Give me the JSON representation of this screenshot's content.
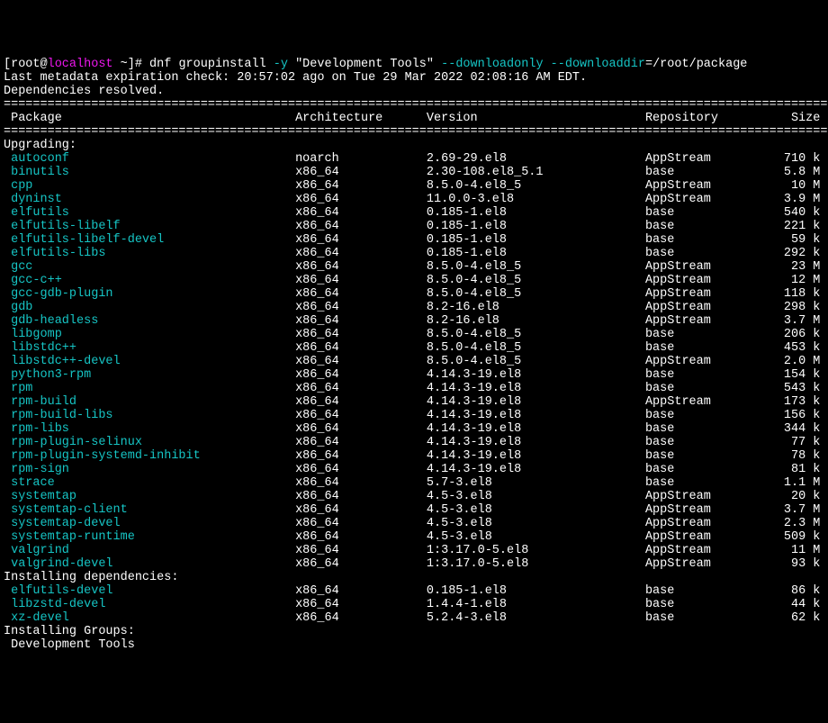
{
  "prompt": {
    "open": "[root@",
    "host": "localhost",
    "close": " ~]# ",
    "cmd1": "dnf groupinstall ",
    "flag_y": "-y",
    "quoted": " \"Development Tools\" ",
    "flag_do": "--downloadonly",
    "space": " ",
    "flag_dd": "--downloaddir",
    "path": "=/root/package"
  },
  "meta_line": "Last metadata expiration check: 20:57:02 ago on Tue 29 Mar 2022 02:08:16 AM EDT.",
  "deps_line": "Dependencies resolved.",
  "rule": "===================================================================================================================",
  "header": {
    "package": " Package",
    "arch": "Architecture",
    "version": "Version",
    "repo": "Repository",
    "size": "Size"
  },
  "section_upgrading": "Upgrading:",
  "section_installing_deps": "Installing dependencies:",
  "section_installing_groups": "Installing Groups:",
  "group_name": " Development Tools",
  "rows": [
    {
      "n": " autoconf",
      "a": "noarch",
      "v": "2.69-29.el8",
      "r": "AppStream",
      "s": "710 k"
    },
    {
      "n": " binutils",
      "a": "x86_64",
      "v": "2.30-108.el8_5.1",
      "r": "base",
      "s": "5.8 M"
    },
    {
      "n": " cpp",
      "a": "x86_64",
      "v": "8.5.0-4.el8_5",
      "r": "AppStream",
      "s": " 10 M"
    },
    {
      "n": " dyninst",
      "a": "x86_64",
      "v": "11.0.0-3.el8",
      "r": "AppStream",
      "s": "3.9 M"
    },
    {
      "n": " elfutils",
      "a": "x86_64",
      "v": "0.185-1.el8",
      "r": "base",
      "s": "540 k"
    },
    {
      "n": " elfutils-libelf",
      "a": "x86_64",
      "v": "0.185-1.el8",
      "r": "base",
      "s": "221 k"
    },
    {
      "n": " elfutils-libelf-devel",
      "a": "x86_64",
      "v": "0.185-1.el8",
      "r": "base",
      "s": " 59 k"
    },
    {
      "n": " elfutils-libs",
      "a": "x86_64",
      "v": "0.185-1.el8",
      "r": "base",
      "s": "292 k"
    },
    {
      "n": " gcc",
      "a": "x86_64",
      "v": "8.5.0-4.el8_5",
      "r": "AppStream",
      "s": " 23 M"
    },
    {
      "n": " gcc-c++",
      "a": "x86_64",
      "v": "8.5.0-4.el8_5",
      "r": "AppStream",
      "s": " 12 M"
    },
    {
      "n": " gcc-gdb-plugin",
      "a": "x86_64",
      "v": "8.5.0-4.el8_5",
      "r": "AppStream",
      "s": "118 k"
    },
    {
      "n": " gdb",
      "a": "x86_64",
      "v": "8.2-16.el8",
      "r": "AppStream",
      "s": "298 k"
    },
    {
      "n": " gdb-headless",
      "a": "x86_64",
      "v": "8.2-16.el8",
      "r": "AppStream",
      "s": "3.7 M"
    },
    {
      "n": " libgomp",
      "a": "x86_64",
      "v": "8.5.0-4.el8_5",
      "r": "base",
      "s": "206 k"
    },
    {
      "n": " libstdc++",
      "a": "x86_64",
      "v": "8.5.0-4.el8_5",
      "r": "base",
      "s": "453 k"
    },
    {
      "n": " libstdc++-devel",
      "a": "x86_64",
      "v": "8.5.0-4.el8_5",
      "r": "AppStream",
      "s": "2.0 M"
    },
    {
      "n": " python3-rpm",
      "a": "x86_64",
      "v": "4.14.3-19.el8",
      "r": "base",
      "s": "154 k"
    },
    {
      "n": " rpm",
      "a": "x86_64",
      "v": "4.14.3-19.el8",
      "r": "base",
      "s": "543 k"
    },
    {
      "n": " rpm-build",
      "a": "x86_64",
      "v": "4.14.3-19.el8",
      "r": "AppStream",
      "s": "173 k"
    },
    {
      "n": " rpm-build-libs",
      "a": "x86_64",
      "v": "4.14.3-19.el8",
      "r": "base",
      "s": "156 k"
    },
    {
      "n": " rpm-libs",
      "a": "x86_64",
      "v": "4.14.3-19.el8",
      "r": "base",
      "s": "344 k"
    },
    {
      "n": " rpm-plugin-selinux",
      "a": "x86_64",
      "v": "4.14.3-19.el8",
      "r": "base",
      "s": " 77 k"
    },
    {
      "n": " rpm-plugin-systemd-inhibit",
      "a": "x86_64",
      "v": "4.14.3-19.el8",
      "r": "base",
      "s": " 78 k"
    },
    {
      "n": " rpm-sign",
      "a": "x86_64",
      "v": "4.14.3-19.el8",
      "r": "base",
      "s": " 81 k"
    },
    {
      "n": " strace",
      "a": "x86_64",
      "v": "5.7-3.el8",
      "r": "base",
      "s": "1.1 M"
    },
    {
      "n": " systemtap",
      "a": "x86_64",
      "v": "4.5-3.el8",
      "r": "AppStream",
      "s": " 20 k"
    },
    {
      "n": " systemtap-client",
      "a": "x86_64",
      "v": "4.5-3.el8",
      "r": "AppStream",
      "s": "3.7 M"
    },
    {
      "n": " systemtap-devel",
      "a": "x86_64",
      "v": "4.5-3.el8",
      "r": "AppStream",
      "s": "2.3 M"
    },
    {
      "n": " systemtap-runtime",
      "a": "x86_64",
      "v": "4.5-3.el8",
      "r": "AppStream",
      "s": "509 k"
    },
    {
      "n": " valgrind",
      "a": "x86_64",
      "v": "1:3.17.0-5.el8",
      "r": "AppStream",
      "s": " 11 M"
    },
    {
      "n": " valgrind-devel",
      "a": "x86_64",
      "v": "1:3.17.0-5.el8",
      "r": "AppStream",
      "s": " 93 k"
    }
  ],
  "rows_deps": [
    {
      "n": " elfutils-devel",
      "a": "x86_64",
      "v": "0.185-1.el8",
      "r": "base",
      "s": " 86 k"
    },
    {
      "n": " libzstd-devel",
      "a": "x86_64",
      "v": "1.4.4-1.el8",
      "r": "base",
      "s": " 44 k"
    },
    {
      "n": " xz-devel",
      "a": "x86_64",
      "v": "5.2.4-3.el8",
      "r": "base",
      "s": " 62 k"
    }
  ]
}
